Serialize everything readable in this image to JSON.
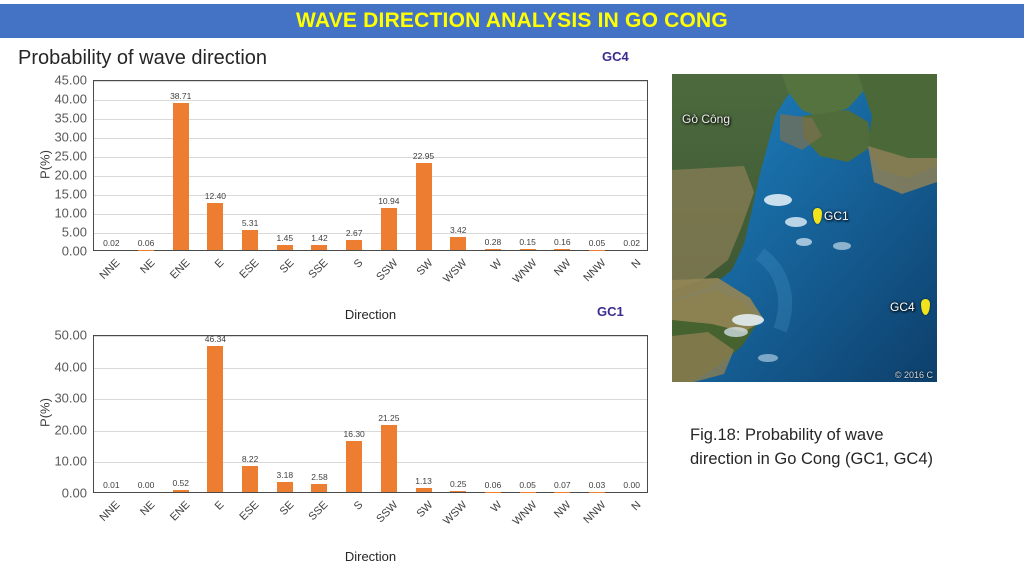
{
  "banner": {
    "title": "WAVE DIRECTION ANALYSIS IN GO CONG",
    "bg_color": "#4472C4",
    "text_color": "#FFFF00"
  },
  "section": {
    "heading": "Probability of wave direction"
  },
  "labels": {
    "gc4": "GC4",
    "gc1": "GC1",
    "label_color": "#3B2B8F"
  },
  "map": {
    "place_name": "Gò Công",
    "pin1_label": "GC1",
    "pin4_label": "GC4",
    "credit": "© 2016 C",
    "pin_color": "#F2E41C"
  },
  "caption": {
    "line1": "Fig.18: Probability of wave",
    "line2": "direction in Go Cong (GC1, GC4)"
  },
  "chart_data": [
    {
      "id": "gc4",
      "type": "bar",
      "title": "",
      "xlabel": "Direction",
      "ylabel": "P(%)",
      "ylim": [
        0,
        45
      ],
      "ytick_step": 5,
      "yticks": [
        "0.00",
        "5.00",
        "10.00",
        "15.00",
        "20.00",
        "25.00",
        "30.00",
        "35.00",
        "40.00",
        "45.00"
      ],
      "grid": true,
      "legend": "GC4",
      "bar_color": "#ED7D31",
      "categories": [
        "NNE",
        "NE",
        "ENE",
        "E",
        "ESE",
        "SE",
        "SSE",
        "S",
        "SSW",
        "SW",
        "WSW",
        "W",
        "WNW",
        "NW",
        "NNW",
        "N"
      ],
      "values": [
        0.02,
        0.06,
        38.71,
        12.4,
        5.31,
        1.45,
        1.42,
        2.67,
        10.94,
        22.95,
        3.42,
        0.28,
        0.15,
        0.16,
        0.05,
        0.02
      ],
      "value_labels": [
        "0.02",
        "0.06",
        "38.71",
        "12.40",
        "5.31",
        "1.45",
        "1.42",
        "2.67",
        "10.94",
        "22.95",
        "3.42",
        "0.28",
        "0.15",
        "0.16",
        "0.05",
        "0.02"
      ]
    },
    {
      "id": "gc1",
      "type": "bar",
      "title": "",
      "xlabel": "Direction",
      "ylabel": "P(%)",
      "ylim": [
        0,
        50
      ],
      "ytick_step": 10,
      "yticks": [
        "0.00",
        "10.00",
        "20.00",
        "30.00",
        "40.00",
        "50.00"
      ],
      "grid": true,
      "legend": "GC1",
      "bar_color": "#ED7D31",
      "categories": [
        "NNE",
        "NE",
        "ENE",
        "E",
        "ESE",
        "SE",
        "SSE",
        "S",
        "SSW",
        "SW",
        "WSW",
        "W",
        "WNW",
        "NW",
        "NNW",
        "N"
      ],
      "values": [
        0.01,
        0.0,
        0.52,
        46.34,
        8.22,
        3.18,
        2.58,
        16.3,
        21.25,
        1.13,
        0.25,
        0.06,
        0.05,
        0.07,
        0.03,
        0.0
      ],
      "value_labels": [
        "0.01",
        "0.00",
        "0.52",
        "46.34",
        "8.22",
        "3.18",
        "2.58",
        "16.30",
        "21.25",
        "1.13",
        "0.25",
        "0.06",
        "0.05",
        "0.07",
        "0.03",
        "0.00"
      ]
    }
  ]
}
